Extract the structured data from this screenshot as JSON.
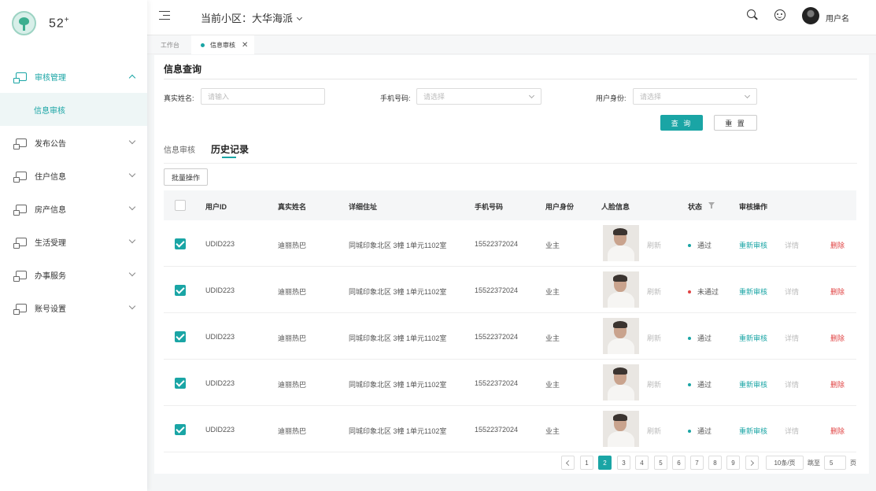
{
  "app": {
    "logo_text": "52",
    "logo_sup": "+"
  },
  "sidebar": {
    "items": [
      {
        "label": "审核管理"
      },
      {
        "label": "信息审核"
      },
      {
        "label": "发布公告"
      },
      {
        "label": "住户信息"
      },
      {
        "label": "房产信息"
      },
      {
        "label": "生活受理"
      },
      {
        "label": "办事服务"
      },
      {
        "label": "账号设置"
      }
    ]
  },
  "header": {
    "community_prefix": "当前小区：",
    "community_name": "大华海派",
    "username": "用户名"
  },
  "page_tabs": [
    {
      "label": "工作台"
    },
    {
      "label": "信息审核"
    }
  ],
  "page": {
    "title": "信息查询"
  },
  "filters": {
    "name_label": "真实姓名:",
    "name_placeholder": "请输入",
    "phone_label": "手机号码:",
    "phone_placeholder": "请选择",
    "role_label": "用户身份:",
    "role_placeholder": "请选择",
    "query_label": "查 询",
    "reset_label": "重 置"
  },
  "subtabs": [
    {
      "label": "信息审核"
    },
    {
      "label": "历史记录"
    }
  ],
  "batch_label": "批量操作",
  "table": {
    "headers": [
      "用户ID",
      "真实姓名",
      "详细住址",
      "手机号码",
      "用户身份",
      "人脸信息",
      "状态",
      "审核操作"
    ],
    "rows": [
      {
        "id": "UDID223",
        "name": "迪丽热巴",
        "address": "同城印象北区 3幢 1单元1102室",
        "phone": "15522372024",
        "role": "业主",
        "face_action": "刷新",
        "status": "通过",
        "status_color": "#1aa5a5",
        "op1": "重新审核",
        "op2": "详情",
        "op3": "删除"
      },
      {
        "id": "UDID223",
        "name": "迪丽热巴",
        "address": "同城印象北区 3幢 1单元1102室",
        "phone": "15522372024",
        "role": "业主",
        "face_action": "刷新",
        "status": "未通过",
        "status_color": "#e04343",
        "op1": "重新审核",
        "op2": "详情",
        "op3": "删除"
      },
      {
        "id": "UDID223",
        "name": "迪丽热巴",
        "address": "同城印象北区 3幢 1单元1102室",
        "phone": "15522372024",
        "role": "业主",
        "face_action": "刷新",
        "status": "通过",
        "status_color": "#1aa5a5",
        "op1": "重新审核",
        "op2": "详情",
        "op3": "删除"
      },
      {
        "id": "UDID223",
        "name": "迪丽热巴",
        "address": "同城印象北区 3幢 1单元1102室",
        "phone": "15522372024",
        "role": "业主",
        "face_action": "刷新",
        "status": "通过",
        "status_color": "#1aa5a5",
        "op1": "重新审核",
        "op2": "详情",
        "op3": "删除"
      },
      {
        "id": "UDID223",
        "name": "迪丽热巴",
        "address": "同城印象北区 3幢 1单元1102室",
        "phone": "15522372024",
        "role": "业主",
        "face_action": "刷新",
        "status": "通过",
        "status_color": "#1aa5a5",
        "op1": "重新审核",
        "op2": "详情",
        "op3": "删除"
      }
    ]
  },
  "pagination": {
    "pages": [
      "1",
      "2",
      "3",
      "4",
      "5",
      "6",
      "7",
      "8",
      "9"
    ],
    "current": "2",
    "page_size": "10条/页",
    "jump_label": "跳至",
    "jump_value": "5",
    "page_suffix": "页"
  },
  "colors": {
    "accent": "#1aa5a5",
    "danger": "#e04343"
  }
}
